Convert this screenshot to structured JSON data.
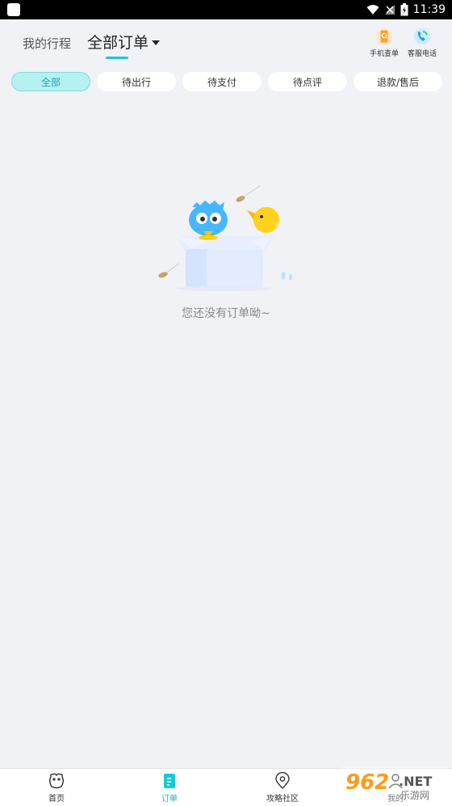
{
  "status_bar": {
    "time": "11:39"
  },
  "header": {
    "tab_trip": "我的行程",
    "tab_all": "全部订单",
    "actions": [
      {
        "label": "手机查单",
        "icon": "phone-search-icon"
      },
      {
        "label": "客服电话",
        "icon": "customer-service-phone-icon"
      }
    ]
  },
  "filters": [
    {
      "label": "全部",
      "active": true
    },
    {
      "label": "待出行",
      "active": false
    },
    {
      "label": "待支付",
      "active": false
    },
    {
      "label": "待点评",
      "active": false
    },
    {
      "label": "退款/售后",
      "active": false
    }
  ],
  "empty_state": {
    "message": "您还没有订单呦~"
  },
  "bottom_nav": [
    {
      "label": "首页",
      "icon": "home-icon",
      "active": false
    },
    {
      "label": "订单",
      "icon": "order-icon",
      "active": true
    },
    {
      "label": "攻略社区",
      "icon": "location-pin-icon",
      "active": false
    },
    {
      "label": "我的",
      "icon": "profile-icon",
      "active": false
    }
  ],
  "watermark": {
    "brand": "962",
    "suffix": ".NET",
    "site": "乐游网"
  },
  "colors": {
    "accent": "#18c9d4",
    "background": "#f1f2f6",
    "active_chip": "#b6f1f1"
  }
}
